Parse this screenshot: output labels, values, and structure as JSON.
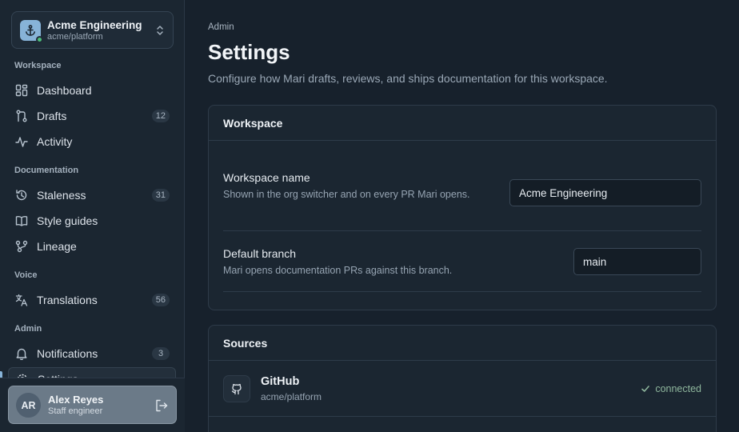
{
  "org": {
    "name": "Acme Engineering",
    "slug": "acme/platform"
  },
  "sidebar": {
    "sections": [
      {
        "label": "Workspace",
        "items": [
          {
            "label": "Dashboard",
            "icon": "dashboard-icon",
            "badge": null
          },
          {
            "label": "Drafts",
            "icon": "git-branch-icon",
            "badge": "12"
          },
          {
            "label": "Activity",
            "icon": "activity-icon",
            "badge": null
          }
        ]
      },
      {
        "label": "Documentation",
        "items": [
          {
            "label": "Staleness",
            "icon": "history-icon",
            "badge": "31"
          },
          {
            "label": "Style guides",
            "icon": "book-icon",
            "badge": null
          },
          {
            "label": "Lineage",
            "icon": "lineage-icon",
            "badge": null
          }
        ]
      },
      {
        "label": "Voice",
        "items": [
          {
            "label": "Translations",
            "icon": "translate-icon",
            "badge": "56"
          }
        ]
      },
      {
        "label": "Admin",
        "items": [
          {
            "label": "Notifications",
            "icon": "bell-icon",
            "badge": "3"
          },
          {
            "label": "Settings",
            "icon": "gear-icon",
            "badge": null,
            "active": true
          }
        ]
      }
    ]
  },
  "user": {
    "initials": "AR",
    "name": "Alex Reyes",
    "role": "Staff engineer"
  },
  "header": {
    "eyebrow": "Admin",
    "title": "Settings",
    "subtitle": "Configure how Mari drafts, reviews, and ships documentation for this workspace."
  },
  "workspace_card": {
    "title": "Workspace",
    "fields": [
      {
        "label": "Workspace name",
        "help": "Shown in the org switcher and on every PR Mari opens.",
        "value": "Acme Engineering"
      },
      {
        "label": "Default branch",
        "help": "Mari opens documentation PRs against this branch.",
        "value": "main"
      }
    ]
  },
  "sources_card": {
    "title": "Sources",
    "items": [
      {
        "name": "GitHub",
        "repo": "acme/platform",
        "status": "connected",
        "icon": "github-icon"
      }
    ]
  },
  "colors": {
    "accent": "#87b3d8",
    "success": "#8fb79d",
    "online": "#4cbf7a"
  }
}
